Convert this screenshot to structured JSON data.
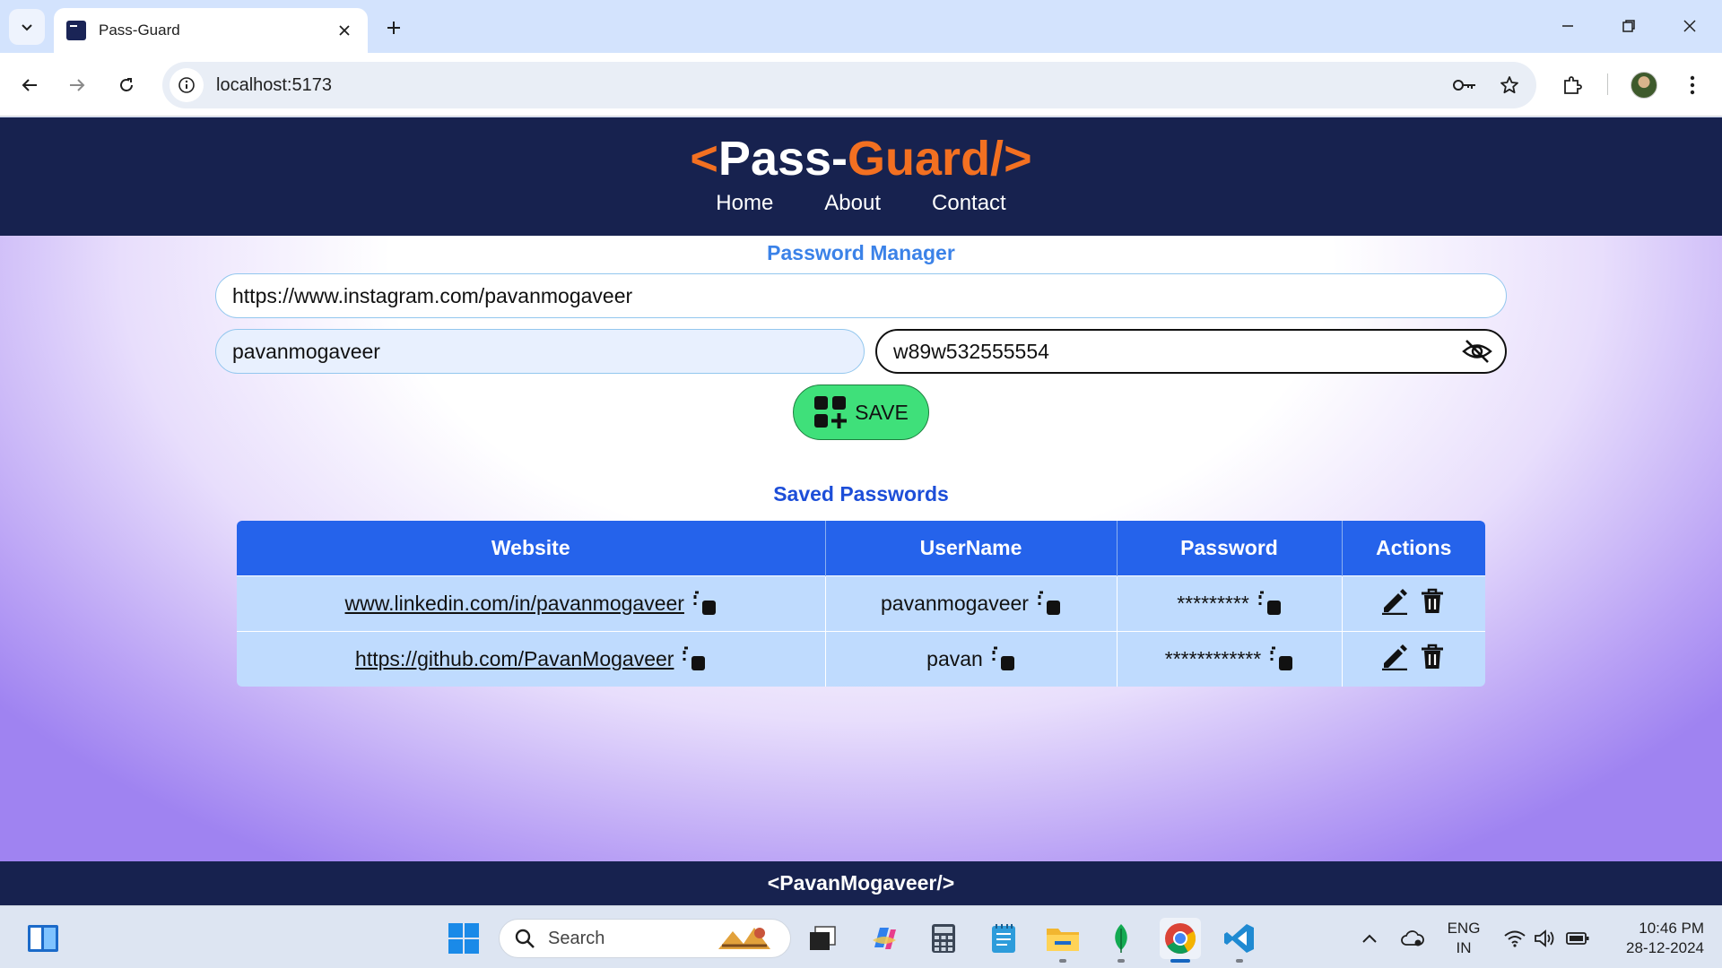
{
  "browser": {
    "tab_title": "Pass-Guard",
    "url": "localhost:5173"
  },
  "app": {
    "logo": {
      "open": "<",
      "part1": "Pass-",
      "part2": "Guard/",
      "close": ">"
    },
    "nav": [
      "Home",
      "About",
      "Contact"
    ],
    "form": {
      "title": "Password Manager",
      "site_value": "https://www.instagram.com/pavanmogaveer",
      "username_value": "pavanmogaveer",
      "password_value": "w89w532555554",
      "save_label": "SAVE"
    },
    "saved": {
      "title": "Saved Passwords",
      "columns": [
        "Website",
        "UserName",
        "Password",
        "Actions"
      ],
      "rows": [
        {
          "website": "www.linkedin.com/in/pavanmogaveer",
          "username": "pavanmogaveer",
          "password": "*********"
        },
        {
          "website": "https://github.com/PavanMogaveer",
          "username": "pavan",
          "password": "************"
        }
      ]
    },
    "footer": "<PavanMogaveer/>"
  },
  "taskbar": {
    "search_label": "Search",
    "lang_line1": "ENG",
    "lang_line2": "IN",
    "time": "10:46 PM",
    "date": "28-12-2024"
  },
  "colors": {
    "nav_bg": "#17224f",
    "logo_accent": "#f37021",
    "table_header": "#2563eb",
    "table_row": "#bfdbfe",
    "save_button": "#3fe07a"
  }
}
